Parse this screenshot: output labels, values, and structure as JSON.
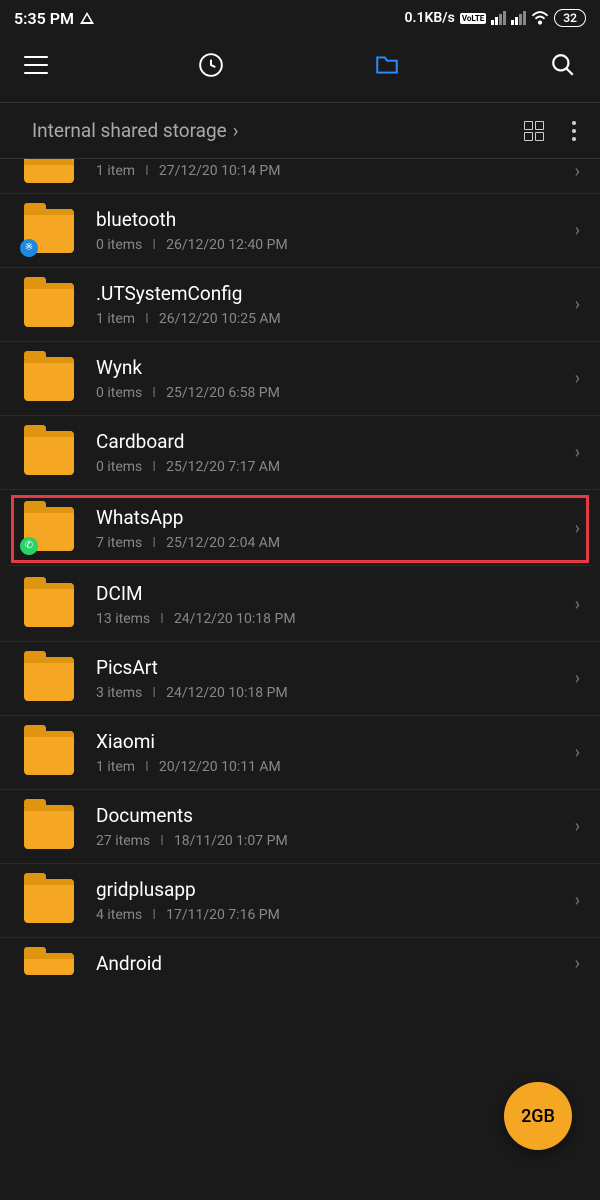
{
  "status": {
    "time": "5:35 PM",
    "speed": "0.1KB/s",
    "battery": "32"
  },
  "breadcrumb": {
    "path": "Internal shared storage"
  },
  "folders": [
    {
      "name": "",
      "items": "1 item",
      "date": "27/12/20 10:14 PM",
      "partial": "top"
    },
    {
      "name": "bluetooth",
      "items": "0 items",
      "date": "26/12/20 12:40 PM",
      "badge": "bluetooth"
    },
    {
      "name": ".UTSystemConfig",
      "items": "1 item",
      "date": "26/12/20 10:25 AM"
    },
    {
      "name": "Wynk",
      "items": "0 items",
      "date": "25/12/20 6:58 PM"
    },
    {
      "name": "Cardboard",
      "items": "0 items",
      "date": "25/12/20 7:17 AM"
    },
    {
      "name": "WhatsApp",
      "items": "7 items",
      "date": "25/12/20 2:04 AM",
      "badge": "whatsapp",
      "highlighted": true
    },
    {
      "name": "DCIM",
      "items": "13 items",
      "date": "24/12/20 10:18 PM"
    },
    {
      "name": "PicsArt",
      "items": "3 items",
      "date": "24/12/20 10:18 PM"
    },
    {
      "name": "Xiaomi",
      "items": "1 item",
      "date": "20/12/20 10:11 AM"
    },
    {
      "name": "Documents",
      "items": "27 items",
      "date": "18/11/20 1:07 PM"
    },
    {
      "name": "gridplusapp",
      "items": "4 items",
      "date": "17/11/20 7:16 PM"
    },
    {
      "name": "Android",
      "items": "",
      "date": "",
      "partial": "bottom"
    }
  ],
  "fab": {
    "label": "2GB"
  }
}
